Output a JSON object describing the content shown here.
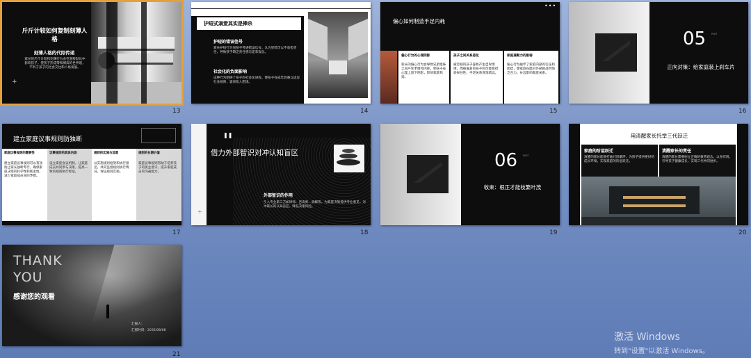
{
  "slides": [
    {
      "num": "13",
      "title": "斤斤计较如何复制刻薄人格",
      "subtitle": "刻薄人格的代际传递",
      "body": "家长的斤斤计较和刻薄行为会在潜移默化中影响孩子，使孩子形成零和博弈的世界观，不利于孩子的社会交往和人格发展。"
    },
    {
      "num": "14",
      "title": "护短式溺爱其实是捧杀",
      "h1": "护短的错误信号",
      "p1": "家长护短行为向孩子传递错误信号，认为犯错可以不承担责任，导致孩子缺乏责任感与是非观念。",
      "h2": "社会化的负面影响",
      "p2": "这种行为阻碍了孩子的社会化进程，使孩子在成年后难以适应社会规则，容易陷入困境。"
    },
    {
      "num": "15",
      "title": "偏心如何制造手足内耗",
      "cols": [
        {
          "h": "偏心行为的心理阴影",
          "p": "家长的偏心行为会导致兄弟姐妹之间产生矛盾和内耗，使孩子在心理上留下阴影，影响家庭和谐。"
        },
        {
          "h": "孩子之间关系恶化",
          "p": "被忽视的孩子容易产生自卑情绪，而被偏爱的孩子则可能变得骄纵任性，手足关系逐渐疏远。"
        },
        {
          "h": "家庭凝聚力的削弱",
          "p": "偏心行为破坏了家庭内部的信任和团结，使家庭在面对外部挑战时缺乏合力，长远影响家庭关系。"
        }
      ]
    },
    {
      "num": "16",
      "section": "05",
      "section_title": "正向对策：给家庭装上刹车片",
      "tag": "PART"
    },
    {
      "num": "17",
      "title": "建立家庭议事规则防独断",
      "cols": [
        {
          "h": "家庭议事规则的重要性",
          "p": "建立家庭议事规则可以有效防止家长独断专行，确保家庭决策的科学性和民主性，减少家庭成员间的矛盾。"
        },
        {
          "h": "议事规则的具体内容",
          "p": "设立家庭会议机制，让家庭成员共同参与决策，提高一致的规则执行标准。"
        },
        {
          "h": "规则的实施与监督",
          "p": "以实施规则框架和执行意见，共同监督规则执行情况，保证规则实施。"
        },
        {
          "h": "规则的长期价值",
          "p": "家庭议事规则有助于培养孩子的民主意识，提升家庭成员的沟通能力。"
        }
      ]
    },
    {
      "num": "18",
      "title": "借力外部智识对冲认知盲区",
      "h": "外部智识的作用",
      "p": "引入专业第三方如律师、咨询师、调解等，为家庭决策提供专业意见，对冲家长的认知盲区，降低决策风险。"
    },
    {
      "num": "19",
      "section": "06",
      "section_title": "收束：根正才能枝繁叶茂",
      "tag": "PART"
    },
    {
      "num": "20",
      "title": "用清醒家长托举三代跃迁",
      "h1": "家庭的阶层跃迁",
      "p1": "清醒的家长能够打破代际循环，为孩子提供更好的成长环境，实现家庭的阶层跃迁。",
      "h2": "清醒家长的责任",
      "p2": "清醒的家长需要树立正确的教育观念，以身作则，引导孩子健康成长，实现三代共同进步。"
    },
    {
      "num": "21",
      "thank1": "THANK",
      "thank2": "YOU",
      "thanks": "感谢您的观看",
      "reporter": "汇报人：",
      "date": "汇报时间：2035/08/08"
    }
  ],
  "watermark": {
    "line1": "激活 Windows",
    "line2": "转到\"设置\"以激活 Windows。"
  }
}
